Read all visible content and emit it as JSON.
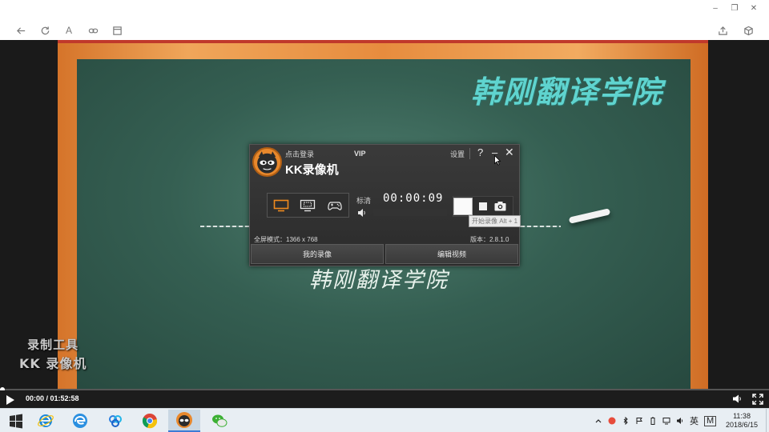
{
  "window": {
    "minimize_glyph": "–",
    "restore_glyph": "❐",
    "close_glyph": "✕"
  },
  "toolbar": {
    "font_glyph": "A",
    "icons": [
      "back-arrow-icon",
      "refresh-icon",
      "font-icon",
      "link-icon",
      "layout-icon",
      "share-icon",
      "box-icon"
    ]
  },
  "video": {
    "board_title": "韩刚翻译学院",
    "board_subtitle": "韩刚翻译学院",
    "watermark_line1": "录制工具",
    "watermark_line2": "KK 录像机"
  },
  "recorder": {
    "login_link": "点击登录",
    "vip_label": "VIP",
    "app_name": "KK录像机",
    "settings_label": "设置",
    "help_glyph": "?",
    "minimize_glyph": "–",
    "close_glyph": "✕",
    "quality_label": "标清",
    "timer": "00:00:09",
    "tooltip": "开始录像 Alt + 1",
    "fullscreen_info": "全屏模式：1366 x 768",
    "version": "版本：2.8.1.0",
    "my_recordings_button": "我的录像",
    "edit_video_button": "编辑视频",
    "modes": [
      "screen-mode-icon",
      "region-mode-icon",
      "game-mode-icon"
    ]
  },
  "player": {
    "time": "00:00 / 01:52:58",
    "progress_fraction": 0.0
  },
  "taskbar": {
    "apps": [
      "windows-start-icon",
      "ie-icon",
      "edge-icon",
      "baidu-netdisk-icon",
      "chrome-icon",
      "kk-recorder-icon",
      "wechat-icon"
    ],
    "tray_lang": "英",
    "tray_ime": "M",
    "clock_time": "11:38",
    "clock_date": "2018/6/15"
  },
  "colors": {
    "board": "#355f52",
    "frame": "#e78c3e",
    "title_teal": "#5fd4cf",
    "kk_orange": "#e8882c",
    "taskbar": "#e8eef3"
  }
}
